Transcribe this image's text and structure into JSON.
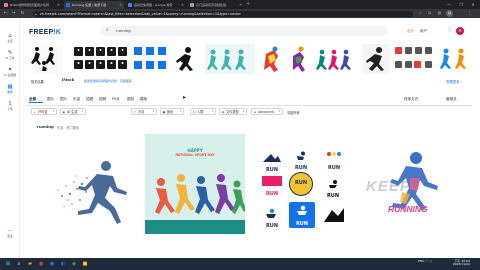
{
  "browser": {
    "tabs": [
      {
        "title": "Bilibili推荐视频页面用户名称",
        "favicon_color": "#fb7299",
        "active": false
      },
      {
        "title": "Running 矢量 | 免费下载",
        "favicon_color": "#1273eb",
        "active": true
      },
      {
        "title": "运动员免费图 - Google 搜索",
        "favicon_color": "#4285f4",
        "active": false
      },
      {
        "title": "冷门运动有声音频集锦",
        "favicon_color": "#9aa0a6",
        "active": false
      }
    ],
    "new_tab": "+",
    "url": "zh.freepik.com/search?format=search&last_filter=selection&last_value=1&query=running&selection=1&type=vector",
    "window_controls": [
      "—",
      "❐",
      "✕"
    ]
  },
  "sidebar": {
    "items": [
      {
        "icon": "⌂",
        "label": "主页"
      },
      {
        "icon": "✎",
        "label": "AI 工具"
      },
      {
        "icon": "✦",
        "label": "AI 生成器"
      },
      {
        "icon": "▦",
        "label": "图库"
      },
      {
        "icon": "⇪",
        "label": "上传"
      },
      {
        "icon": "⋯",
        "label": "更多"
      }
    ]
  },
  "header": {
    "logo_main": "FREEP",
    "logo_k": "!K",
    "search_value": "running",
    "link_pricing": "定价",
    "link_user": "用户",
    "avatar_letter": "A"
  },
  "banner": {
    "label": "相关结果",
    "istock": "iStock",
    "istock_desc": "使用优惠码享受额外折扣 · 高级图库",
    "more": "查看更多 ›"
  },
  "filters": {
    "tabs": [
      "全部",
      "图片",
      "图片",
      "矢量",
      "插图",
      "视频",
      "PSD",
      "图标",
      "模板"
    ],
    "sort_label": "排序方式",
    "sort_value": "最相关",
    "buttons": [
      {
        "label": "许可证",
        "icon": "✓"
      },
      {
        "label": "AI 生成",
        "icon": "◆"
      },
      {
        "label": "方向",
        "icon": "▭"
      },
      {
        "label": "颜色",
        "icon": "●"
      },
      {
        "label": "人物",
        "icon": "☺"
      },
      {
        "label": "文件类型",
        "icon": "▤"
      },
      {
        "label": "Advanced",
        "icon": "≡"
      }
    ],
    "clear_all": "清除所有"
  },
  "results": {
    "query": "running",
    "count": "矢量 · 热门搜索",
    "poster_happy": "HAPPY",
    "poster_title": "NATIONAL SPORT DAY",
    "logo_texts": [
      "RUN",
      "RUN",
      "RUN",
      "RUN",
      "RUN",
      "RUN",
      "RUN",
      "RUN"
    ],
    "keep_title": "KEEP",
    "keep_sub": "RUNNING"
  },
  "taskbar": {
    "tray_text": "ENG",
    "time": "下午 10:04",
    "date": "2023/11/22"
  },
  "colors": {
    "accent": "#1273eb",
    "logo_dark": "#0e2a47",
    "chrome_dark": "#202124"
  }
}
